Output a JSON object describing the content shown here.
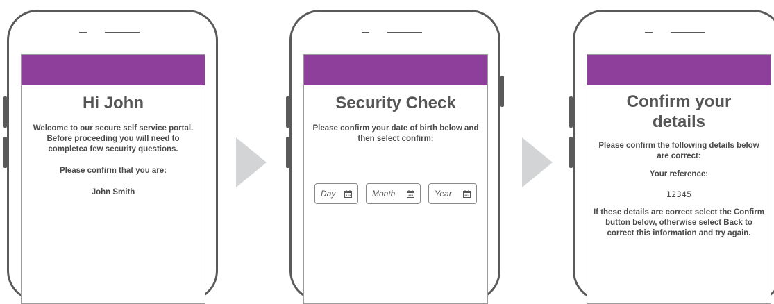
{
  "screens": [
    {
      "title": "Hi John",
      "intro": "Welcome to our secure self service portal. Before proceeding you will need to completea few security questions.",
      "prompt": "Please confirm that you are:",
      "name": "John Smith"
    },
    {
      "title": "Security Check",
      "intro": "Please confirm your date of birth below and then select confirm:",
      "fields": {
        "day": "Day",
        "month": "Month",
        "year": "Year"
      }
    },
    {
      "title_line1": "Confirm your",
      "title_line2": "details",
      "intro": "Please confirm the following details below are correct:",
      "reference_label": "Your reference:",
      "reference_value": "12345",
      "instructions": "If these details are correct select the Confirm button below, otherwise select Back to correct this information and try again."
    }
  ],
  "colors": {
    "header": "#8e3f9c",
    "arrow": "#d3d4d5",
    "frame": "#5a5a5a"
  },
  "icons": {
    "date_field": "calendar-icon",
    "flow": "arrow-right-icon"
  }
}
